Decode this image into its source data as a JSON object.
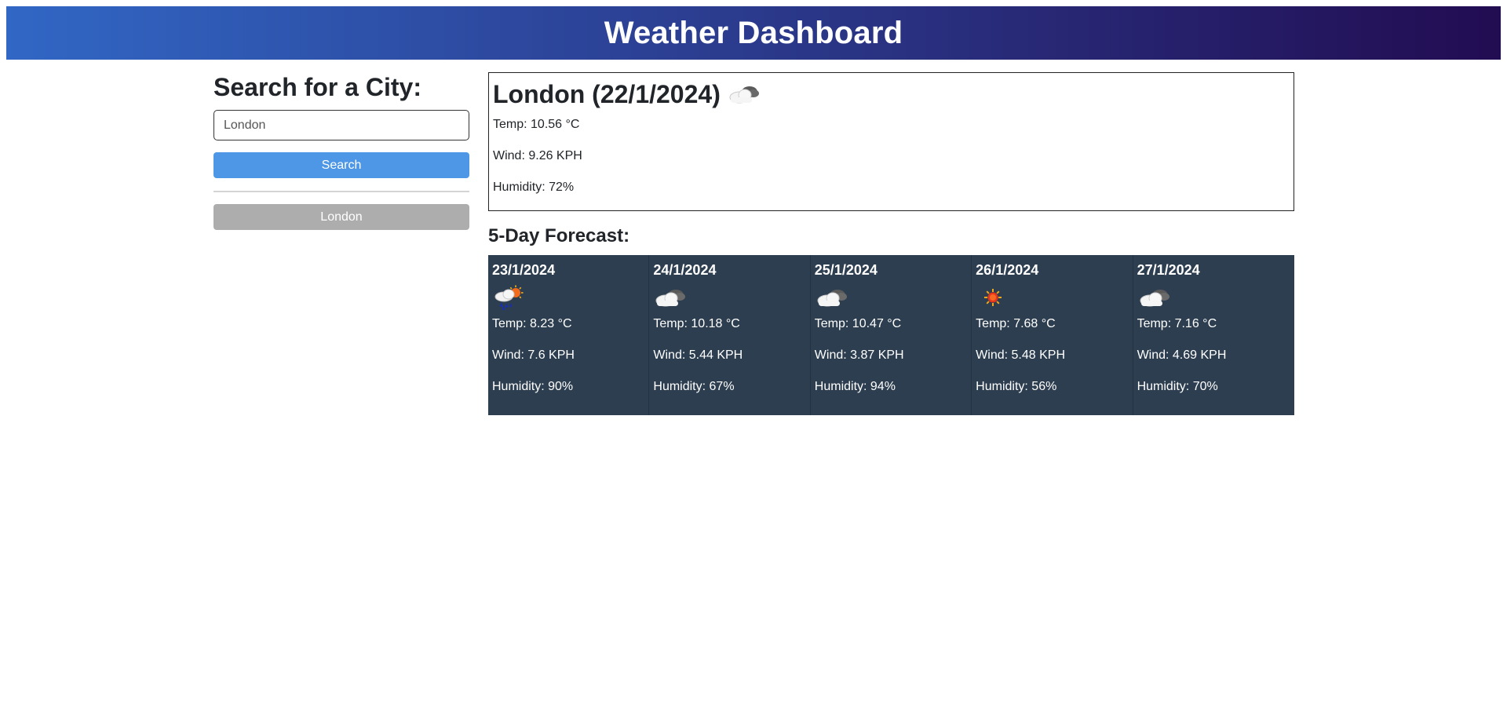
{
  "header": {
    "title": "Weather Dashboard"
  },
  "sidebar": {
    "heading": "Search for a City:",
    "input_value": "London",
    "search_label": "Search",
    "history": [
      "London"
    ]
  },
  "current": {
    "title": "London (22/1/2024)",
    "icon": "clouds-icon",
    "temp": "Temp: 10.56 °C",
    "wind": "Wind: 9.26 KPH",
    "humidity": "Humidity: 72%"
  },
  "forecast": {
    "heading": "5-Day Forecast:",
    "days": [
      {
        "date": "23/1/2024",
        "icon": "rain-sun-icon",
        "temp": "Temp: 8.23 °C",
        "wind": "Wind: 7.6 KPH",
        "humidity": "Humidity: 90%"
      },
      {
        "date": "24/1/2024",
        "icon": "clouds-icon",
        "temp": "Temp: 10.18 °C",
        "wind": "Wind: 5.44 KPH",
        "humidity": "Humidity: 67%"
      },
      {
        "date": "25/1/2024",
        "icon": "clouds-icon",
        "temp": "Temp: 10.47 °C",
        "wind": "Wind: 3.87 KPH",
        "humidity": "Humidity: 94%"
      },
      {
        "date": "26/1/2024",
        "icon": "sun-icon",
        "temp": "Temp: 7.68 °C",
        "wind": "Wind: 5.48 KPH",
        "humidity": "Humidity: 56%"
      },
      {
        "date": "27/1/2024",
        "icon": "clouds-icon",
        "temp": "Temp: 7.16 °C",
        "wind": "Wind: 4.69 KPH",
        "humidity": "Humidity: 70%"
      }
    ]
  },
  "colors": {
    "header_start": "#3167c5",
    "header_end": "#220c52",
    "search_button": "#4e97e6",
    "history_button": "#adadad",
    "forecast_card": "#2d3e50"
  }
}
